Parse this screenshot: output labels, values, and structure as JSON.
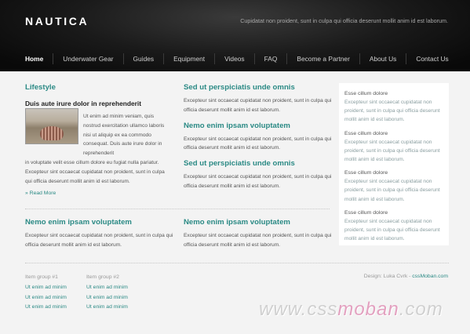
{
  "header": {
    "logo": "NAUTICA",
    "tagline": "Cupidatat non proident, sunt in culpa qui officia deserunt mollit anim id est laborum."
  },
  "nav": {
    "items": [
      "Home",
      "Underwater Gear",
      "Guides",
      "Equipment",
      "Videos",
      "FAQ",
      "Become a Partner",
      "About Us",
      "Contact Us"
    ],
    "active": "Home"
  },
  "col1": {
    "heading": "Lifestyle",
    "subheading": "Duis aute irure dolor in reprehenderit",
    "text_wrap": "Ut enim ad minim veniam, quis nostrud exercitation ullamco laboris nisi ut aliquip ex ea commodo consequat. Duis aute irure dolor in reprehenderit",
    "text_full": "in voluptate velit esse cillum dolore eu fugiat nulla pariatur. Excepteur sint occaecat cupidatat non proident, sunt in culpa qui officia deserunt mollit anim id est laborum.",
    "read_more": "» Read More"
  },
  "col2": [
    {
      "heading": "Sed ut perspiciatis unde omnis",
      "text": "Excepteur sint occaecat cupidatat non proident, sunt in culpa qui officia deserunt mollit anim id est laborum."
    },
    {
      "heading": "Nemo enim ipsam voluptatem",
      "text": "Excepteur sint occaecat cupidatat non proident, sunt in culpa qui officia deserunt mollit anim id est laborum."
    },
    {
      "heading": "Sed ut perspiciatis unde omnis",
      "text": "Excepteur sint occaecat cupidatat non proident, sunt in culpa qui officia deserunt mollit anim id est laborum."
    }
  ],
  "sidebar": [
    {
      "title": "Esse cillum dolore",
      "text": "Excepteur sint occaecat cupidatat non proident, sunt in culpa qui officia deserunt mollit anim id est laborum."
    },
    {
      "title": "Esse cillum dolore",
      "text": "Excepteur sint occaecat cupidatat non proident, sunt in culpa qui officia deserunt mollit anim id est laborum."
    },
    {
      "title": "Esse cillum dolore",
      "text": "Excepteur sint occaecat cupidatat non proident, sunt in culpa qui officia deserunt mollit anim id est laborum."
    },
    {
      "title": "Esse cillum dolore",
      "text": "Excepteur sint occaecat cupidatat non proident, sunt in culpa qui officia deserunt mollit anim id est laborum."
    }
  ],
  "bottom": [
    {
      "heading": "Nemo enim ipsam voluptatem",
      "text": "Excepteur sint occaecat cupidatat non proident, sunt in culpa qui officia deserunt mollit anim id est laborum."
    },
    {
      "heading": "Nemo enim ipsam voluptatem",
      "text": "Excepteur sint occaecat cupidatat non proident, sunt in culpa qui officia deserunt mollit anim id est laborum."
    }
  ],
  "footer": {
    "group1": {
      "title": "Item group #1",
      "links": [
        "Ut enim ad minim",
        "Ut enim ad minim",
        "Ut enim ad minim"
      ]
    },
    "group2": {
      "title": "Item group #2",
      "links": [
        "Ut enim ad minim",
        "Ut enim ad minim",
        "Ut enim ad minim"
      ]
    },
    "credit_prefix": "Design: Luka Cvrk - ",
    "credit_link": "cssMoban.com"
  },
  "watermark": {
    "part1": "www.css",
    "part2": "moban",
    "part3": ".com"
  },
  "colors": {
    "accent": "#2b8a85",
    "header_bg": "#111111",
    "page_bg": "#f3f3f3"
  }
}
